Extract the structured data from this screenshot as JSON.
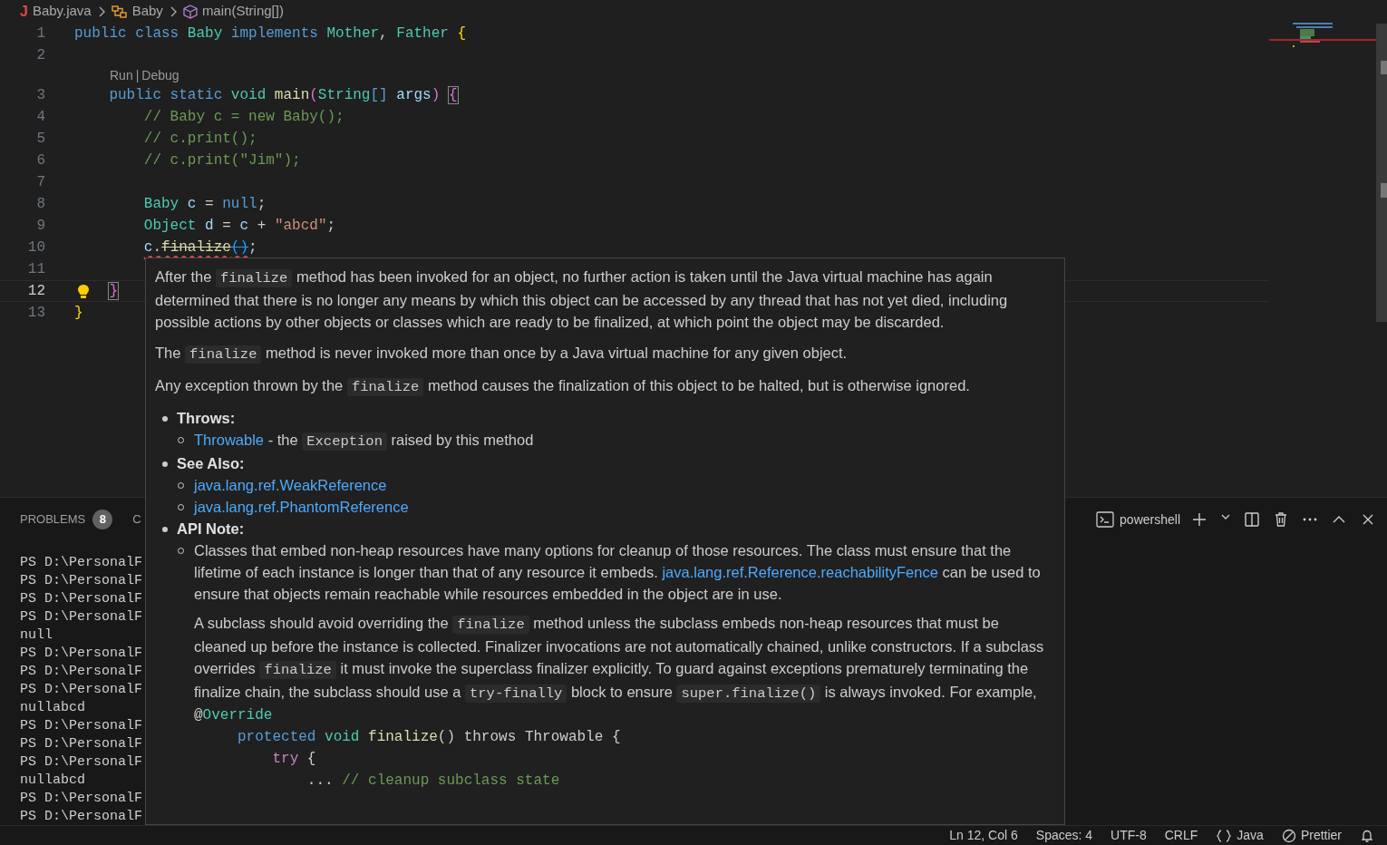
{
  "breadcrumb": [
    {
      "kind": "file",
      "icon_letter": "J",
      "label": "Baby.java"
    },
    {
      "kind": "class",
      "label": "Baby"
    },
    {
      "kind": "method",
      "label": "main(String[])"
    }
  ],
  "editor": {
    "lines": [
      {
        "number": "1",
        "current": false,
        "tokens": [
          {
            "text": "public class ",
            "kind": "keyword"
          },
          {
            "text": "Baby",
            "kind": "type"
          },
          {
            "text": " implements ",
            "kind": "keyword"
          },
          {
            "text": "Mother",
            "kind": "type"
          },
          {
            "text": ", ",
            "kind": "plain"
          },
          {
            "text": "Father",
            "kind": "type"
          },
          {
            "text": " {",
            "kind": "bracket1"
          }
        ]
      },
      {
        "number": "2",
        "current": false
      },
      {
        "number": "3",
        "current": false,
        "codelens": {
          "items": [
            "Run",
            "Debug"
          ],
          "separator": "|"
        },
        "tokens": [
          {
            "text": "    public static ",
            "kind": "keyword"
          },
          {
            "text": "void ",
            "kind": "type"
          },
          {
            "text": "main",
            "kind": "function"
          },
          {
            "text": "(",
            "kind": "bracket2"
          },
          {
            "text": "String",
            "kind": "type"
          },
          {
            "text": "[]",
            "kind": "keyword"
          },
          {
            "text": " args",
            "kind": "variable"
          },
          {
            "text": ")",
            "kind": "bracket2"
          },
          {
            "text": " {",
            "kind": "bracket2",
            "boxed": true
          }
        ]
      },
      {
        "number": "4",
        "current": false,
        "tokens": [
          {
            "text": "        // Baby c = new Baby();",
            "kind": "comment"
          }
        ]
      },
      {
        "number": "5",
        "current": false,
        "tokens": [
          {
            "text": "        // c.print();",
            "kind": "comment"
          }
        ]
      },
      {
        "number": "6",
        "current": false,
        "tokens": [
          {
            "text": "        // c.print(\"Jim\");",
            "kind": "comment"
          }
        ]
      },
      {
        "number": "7",
        "current": false
      },
      {
        "number": "8",
        "current": false,
        "tokens": [
          {
            "text": "        Baby",
            "kind": "type"
          },
          {
            "text": " c",
            "kind": "variable"
          },
          {
            "text": " = ",
            "kind": "plain"
          },
          {
            "text": "null",
            "kind": "keyword"
          },
          {
            "text": ";",
            "kind": "plain"
          }
        ]
      },
      {
        "number": "9",
        "current": false,
        "tokens": [
          {
            "text": "        Object",
            "kind": "type"
          },
          {
            "text": " d",
            "kind": "variable"
          },
          {
            "text": " = ",
            "kind": "plain"
          },
          {
            "text": "c",
            "kind": "variable"
          },
          {
            "text": " + ",
            "kind": "plain"
          },
          {
            "text": "\"abcd\"",
            "kind": "string"
          },
          {
            "text": ";",
            "kind": "plain"
          }
        ]
      },
      {
        "number": "10",
        "current": false,
        "tokens": [
          {
            "text": "        c",
            "kind": "variable",
            "error": true
          },
          {
            "text": ".",
            "kind": "plain",
            "error": true
          },
          {
            "text": "finalize",
            "kind": "function",
            "error": true,
            "deprecated": true
          },
          {
            "text": "()",
            "kind": "bracket3",
            "error": true,
            "deprecated": true
          },
          {
            "text": ";",
            "kind": "plain"
          }
        ]
      },
      {
        "number": "11",
        "current": false
      },
      {
        "number": "12",
        "current": true,
        "lightbulb": true,
        "tokens": [
          {
            "text": "    }",
            "kind": "bracket2",
            "boxed": true
          }
        ]
      },
      {
        "number": "13",
        "current": false,
        "tokens": [
          {
            "text": "}",
            "kind": "bracket1"
          }
        ]
      }
    ]
  },
  "hover": {
    "paragraphs": [
      [
        {
          "kind": "text",
          "text": "After the "
        },
        {
          "kind": "code",
          "text": "finalize"
        },
        {
          "kind": "text",
          "text": " method has been invoked for an object, no further action is taken until the Java virtual machine has again determined that there is no longer any means by which this object can be accessed by any thread that has not yet died, including possible actions by other objects or classes which are ready to be finalized, at which point the object may be discarded."
        }
      ],
      [
        {
          "kind": "text",
          "text": "The "
        },
        {
          "kind": "code",
          "text": "finalize"
        },
        {
          "kind": "text",
          "text": " method is never invoked more than once by a Java virtual machine for any given object."
        }
      ],
      [
        {
          "kind": "text",
          "text": "Any exception thrown by the "
        },
        {
          "kind": "code",
          "text": "finalize"
        },
        {
          "kind": "text",
          "text": " method causes the finalization of this object to be halted, but is otherwise ignored."
        }
      ]
    ],
    "sections": [
      {
        "heading": "Throws:",
        "items": [
          {
            "paragraphs": [
              [
                {
                  "kind": "link",
                  "text": "Throwable"
                },
                {
                  "kind": "text",
                  "text": " - the "
                },
                {
                  "kind": "code",
                  "text": "Exception"
                },
                {
                  "kind": "text",
                  "text": " raised by this method"
                }
              ]
            ]
          }
        ]
      },
      {
        "heading": "See Also:",
        "items": [
          {
            "paragraphs": [
              [
                {
                  "kind": "link",
                  "text": "java.lang.ref.WeakReference"
                }
              ]
            ]
          },
          {
            "paragraphs": [
              [
                {
                  "kind": "link",
                  "text": "java.lang.ref.PhantomReference"
                }
              ]
            ]
          }
        ]
      },
      {
        "heading": "API Note:",
        "items": [
          {
            "paragraphs": [
              [
                {
                  "kind": "text",
                  "text": "Classes that embed non-heap resources have many options for cleanup of those resources. The class must ensure that the lifetime of each instance is longer than that of any resource it embeds. "
                },
                {
                  "kind": "link",
                  "text": "java.lang.ref.Reference.reachabilityFence"
                },
                {
                  "kind": "text",
                  "text": " can be used to ensure that objects remain reachable while resources embedded in the object are in use."
                }
              ],
              [
                {
                  "kind": "text",
                  "text": "A subclass should avoid overriding the "
                },
                {
                  "kind": "code",
                  "text": "finalize"
                },
                {
                  "kind": "text",
                  "text": " method unless the subclass embeds non-heap resources that must be cleaned up before the instance is collected. Finalizer invocations are not automatically chained, unlike constructors. If a subclass overrides "
                },
                {
                  "kind": "code",
                  "text": "finalize"
                },
                {
                  "kind": "text",
                  "text": " it must invoke the superclass finalizer explicitly. To guard against exceptions prematurely terminating the finalize chain, the subclass should use a "
                },
                {
                  "kind": "code",
                  "text": "try-finally"
                },
                {
                  "kind": "text",
                  "text": " block to ensure "
                },
                {
                  "kind": "code",
                  "text": "super.finalize()"
                },
                {
                  "kind": "text",
                  "text": " is always invoked. For example,"
                }
              ]
            ],
            "code_lines": [
              [
                {
                  "text": "@",
                  "kind": "plain"
                },
                {
                  "text": "Override",
                  "kind": "type"
                }
              ],
              [
                {
                  "text": "     protected ",
                  "kind": "keyword"
                },
                {
                  "text": "void ",
                  "kind": "type"
                },
                {
                  "text": "finalize",
                  "kind": "function"
                },
                {
                  "text": "() throws Throwable {",
                  "kind": "plain"
                }
              ],
              [
                {
                  "text": "         try",
                  "kind": "control"
                },
                {
                  "text": " {",
                  "kind": "plain"
                }
              ],
              [
                {
                  "text": "             ... ",
                  "kind": "plain"
                },
                {
                  "text": "// cleanup subclass state",
                  "kind": "comment"
                }
              ]
            ]
          }
        ]
      }
    ]
  },
  "panel": {
    "tabs": [
      {
        "label": "PROBLEMS",
        "badge": "8",
        "selected": false
      },
      {
        "label": "C",
        "selected": false
      }
    ],
    "terminal_lines": [
      "PS D:\\PersonalF",
      "PS D:\\PersonalF",
      "PS D:\\PersonalF",
      "PS D:\\PersonalF",
      "null",
      "PS D:\\PersonalF",
      "PS D:\\PersonalF",
      "PS D:\\PersonalF",
      "nullabcd",
      "PS D:\\PersonalF",
      "PS D:\\PersonalF",
      "PS D:\\PersonalF",
      "nullabcd",
      "PS D:\\PersonalF",
      "PS D:\\PersonalF"
    ],
    "shell": "powershell"
  },
  "status_bar": [
    {
      "kind": "text",
      "text": "Ln 12, Col 6"
    },
    {
      "kind": "text",
      "text": "Spaces: 4"
    },
    {
      "kind": "text",
      "text": "UTF-8"
    },
    {
      "kind": "text",
      "text": "CRLF"
    },
    {
      "kind": "language",
      "text": "Java"
    },
    {
      "kind": "formatter",
      "text": "Prettier"
    },
    {
      "kind": "bell"
    }
  ]
}
